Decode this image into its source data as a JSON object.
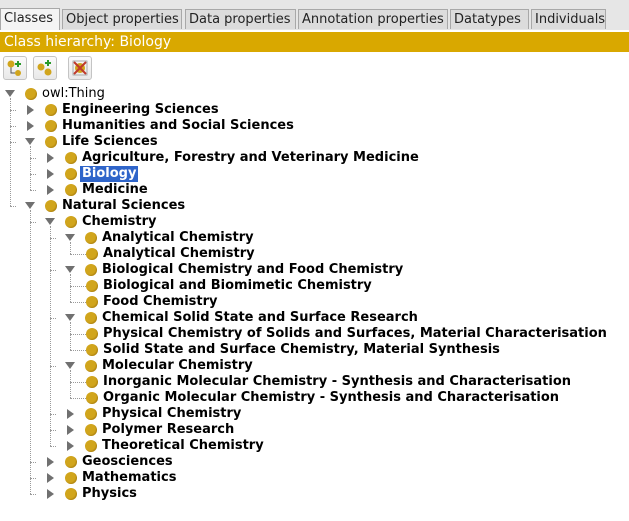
{
  "tabs": [
    {
      "label": "Classes",
      "active": true
    },
    {
      "label": "Object properties"
    },
    {
      "label": "Data properties"
    },
    {
      "label": "Annotation properties"
    },
    {
      "label": "Datatypes"
    },
    {
      "label": "Individuals"
    }
  ],
  "title": "Class hierarchy: Biology",
  "toolbar": {
    "buttons": [
      {
        "icon": "add-subclass-icon"
      },
      {
        "icon": "add-sibling-class-icon"
      },
      {
        "icon": "delete-class-icon"
      }
    ]
  },
  "tree": [
    {
      "label": "owl:Thing",
      "depth": 0,
      "state": "expanded",
      "root": true
    },
    {
      "label": "Engineering Sciences",
      "depth": 1,
      "state": "collapsed"
    },
    {
      "label": "Humanities and Social Sciences",
      "depth": 1,
      "state": "collapsed"
    },
    {
      "label": "Life Sciences",
      "depth": 1,
      "state": "expanded"
    },
    {
      "label": "Agriculture, Forestry and Veterinary Medicine",
      "depth": 2,
      "state": "collapsed"
    },
    {
      "label": "Biology",
      "depth": 2,
      "state": "collapsed",
      "selected": true
    },
    {
      "label": "Medicine",
      "depth": 2,
      "state": "collapsed"
    },
    {
      "label": "Natural Sciences",
      "depth": 1,
      "state": "expanded"
    },
    {
      "label": "Chemistry",
      "depth": 2,
      "state": "expanded"
    },
    {
      "label": "Analytical Chemistry",
      "depth": 3,
      "state": "expanded"
    },
    {
      "label": "Analytical Chemistry",
      "depth": 4,
      "state": "leaf"
    },
    {
      "label": "Biological Chemistry and Food Chemistry",
      "depth": 3,
      "state": "expanded"
    },
    {
      "label": "Biological and Biomimetic Chemistry",
      "depth": 4,
      "state": "leaf"
    },
    {
      "label": "Food Chemistry",
      "depth": 4,
      "state": "leaf"
    },
    {
      "label": "Chemical Solid State and Surface Research",
      "depth": 3,
      "state": "expanded"
    },
    {
      "label": "Physical Chemistry of Solids and Surfaces, Material Characterisation",
      "depth": 4,
      "state": "leaf"
    },
    {
      "label": "Solid State and Surface Chemistry, Material Synthesis",
      "depth": 4,
      "state": "leaf"
    },
    {
      "label": "Molecular Chemistry",
      "depth": 3,
      "state": "expanded"
    },
    {
      "label": "Inorganic Molecular Chemistry - Synthesis and Characterisation",
      "depth": 4,
      "state": "leaf"
    },
    {
      "label": "Organic Molecular Chemistry - Synthesis and Characterisation",
      "depth": 4,
      "state": "leaf"
    },
    {
      "label": "Physical Chemistry",
      "depth": 3,
      "state": "collapsed"
    },
    {
      "label": "Polymer Research",
      "depth": 3,
      "state": "collapsed"
    },
    {
      "label": "Theoretical Chemistry",
      "depth": 3,
      "state": "collapsed"
    },
    {
      "label": "Geosciences",
      "depth": 2,
      "state": "collapsed"
    },
    {
      "label": "Mathematics",
      "depth": 2,
      "state": "collapsed"
    },
    {
      "label": "Physics",
      "depth": 2,
      "state": "collapsed"
    }
  ]
}
